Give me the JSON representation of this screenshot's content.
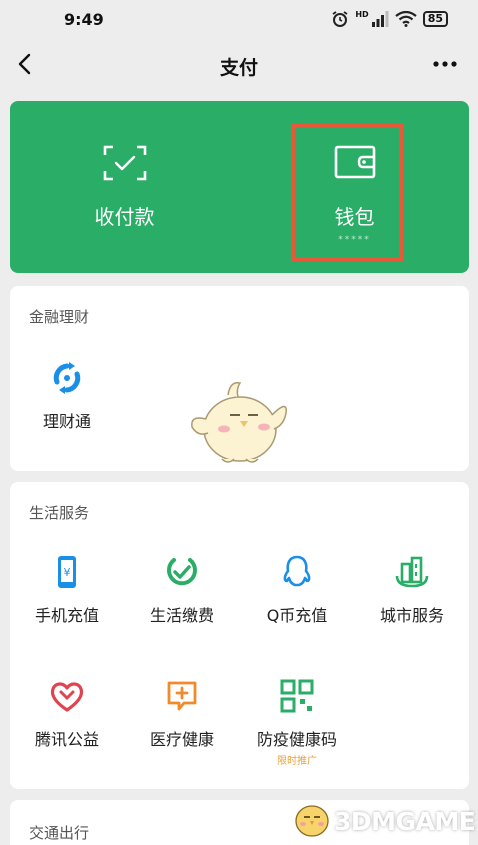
{
  "status_bar": {
    "time": "9:49",
    "network": "HD",
    "battery": "85"
  },
  "nav": {
    "title": "支付",
    "back_icon": "chevron-left-icon",
    "more_icon": "more-dots-icon"
  },
  "green_card": {
    "color": "#2aae67",
    "collect_pay_label": "收付款",
    "wallet_label": "钱包",
    "wallet_balance_mask": "*****",
    "highlight_color": "#e8593a"
  },
  "finance": {
    "title": "金融理财",
    "items": [
      {
        "label": "理财通",
        "icon": "licaitong-icon"
      }
    ]
  },
  "life_services": {
    "title": "生活服务",
    "items": [
      {
        "label": "手机充值",
        "icon": "phone-recharge-icon"
      },
      {
        "label": "生活缴费",
        "icon": "utility-bill-icon"
      },
      {
        "label": "Q币充值",
        "icon": "qq-coin-icon"
      },
      {
        "label": "城市服务",
        "icon": "city-service-icon"
      },
      {
        "label": "腾讯公益",
        "icon": "charity-heart-icon"
      },
      {
        "label": "医疗健康",
        "icon": "medical-health-icon"
      },
      {
        "label": "防疫健康码",
        "icon": "health-qr-code-icon",
        "tag": "限时推广"
      }
    ]
  },
  "transport": {
    "title": "交通出行"
  },
  "watermark": {
    "text": "3DMGAME"
  }
}
